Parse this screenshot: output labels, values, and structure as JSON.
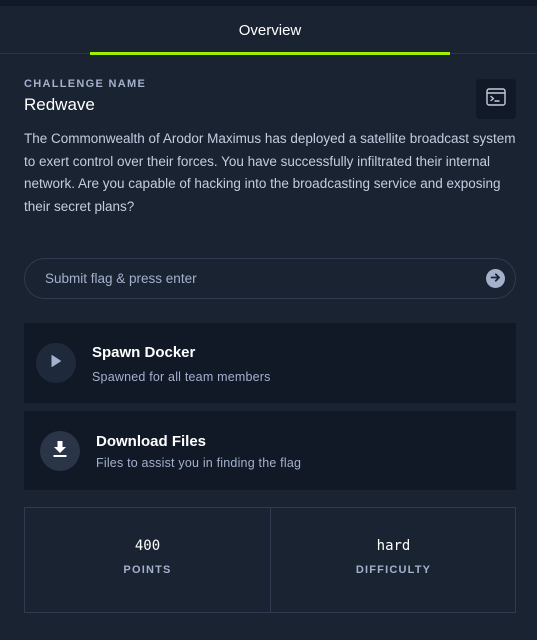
{
  "tabs": [
    {
      "label": "Overview",
      "active": true
    }
  ],
  "challenge": {
    "name_label": "CHALLENGE NAME",
    "name": "Redwave",
    "description": "The Commonwealth of Arodor Maximus has deployed a satellite broadcast system to exert control over their forces. You have successfully infiltrated their internal network. Are you capable of hacking into the broadcasting service and exposing their secret plans?"
  },
  "flag_input": {
    "placeholder": "Submit flag & press enter",
    "value": ""
  },
  "spawn": {
    "title": "Spawn Docker",
    "subtitle": "Spawned for all team members"
  },
  "download": {
    "title": "Download Files",
    "subtitle": "Files to assist you in finding the flag"
  },
  "stats": {
    "points_value": "400",
    "points_label": "POINTS",
    "difficulty_value": "hard",
    "difficulty_label": "DIFFICULTY"
  },
  "icons": {
    "console": "terminal-window-icon",
    "submit": "arrow-right-circle-icon",
    "spawn": "play-icon",
    "download": "download-icon"
  },
  "colors": {
    "background": "#1a2332",
    "card": "#111927",
    "accent": "#9fef00",
    "muted_text": "#a4b1cd"
  }
}
